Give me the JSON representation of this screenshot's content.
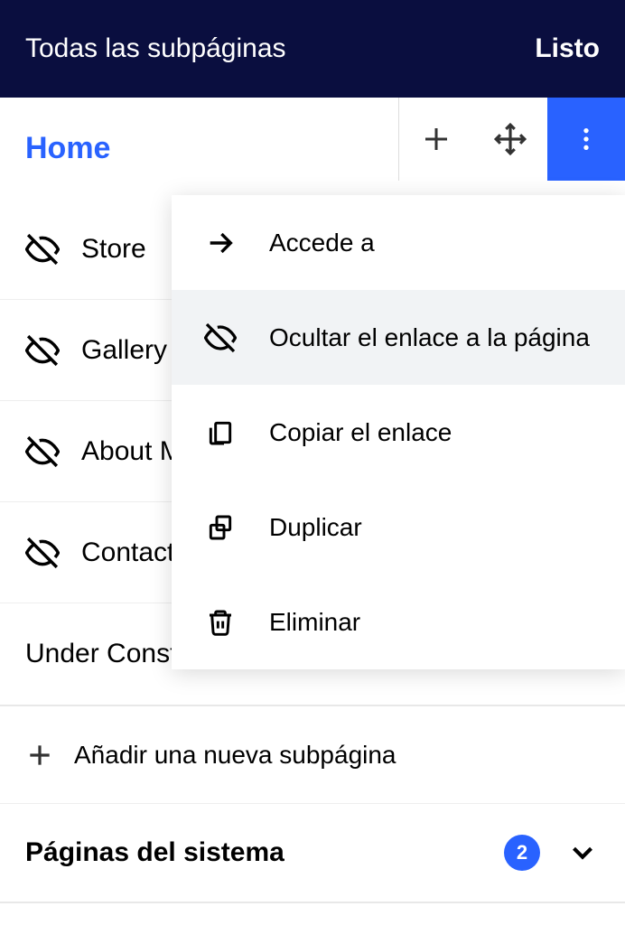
{
  "header": {
    "title": "Todas las subpáginas",
    "done": "Listo"
  },
  "pages": [
    {
      "name": "Home",
      "hidden": false,
      "selected": true
    },
    {
      "name": "Store",
      "hidden": true,
      "selected": false
    },
    {
      "name": "Gallery",
      "hidden": true,
      "selected": false
    },
    {
      "name": "About Me",
      "hidden": true,
      "selected": false
    },
    {
      "name": "Contact",
      "hidden": true,
      "selected": false
    },
    {
      "name": "Under Construction",
      "hidden": false,
      "selected": false
    }
  ],
  "context_menu": [
    {
      "icon": "arrow-right",
      "label": "Accede a",
      "highlighted": false
    },
    {
      "icon": "hide",
      "label": "Ocultar el enlace a la página",
      "highlighted": true
    },
    {
      "icon": "copy-link",
      "label": "Copiar el enlace",
      "highlighted": false
    },
    {
      "icon": "duplicate",
      "label": "Duplicar",
      "highlighted": false
    },
    {
      "icon": "trash",
      "label": "Eliminar",
      "highlighted": false
    }
  ],
  "add_subpage": "Añadir una nueva subpágina",
  "system_pages": {
    "title": "Páginas del sistema",
    "count": "2"
  }
}
